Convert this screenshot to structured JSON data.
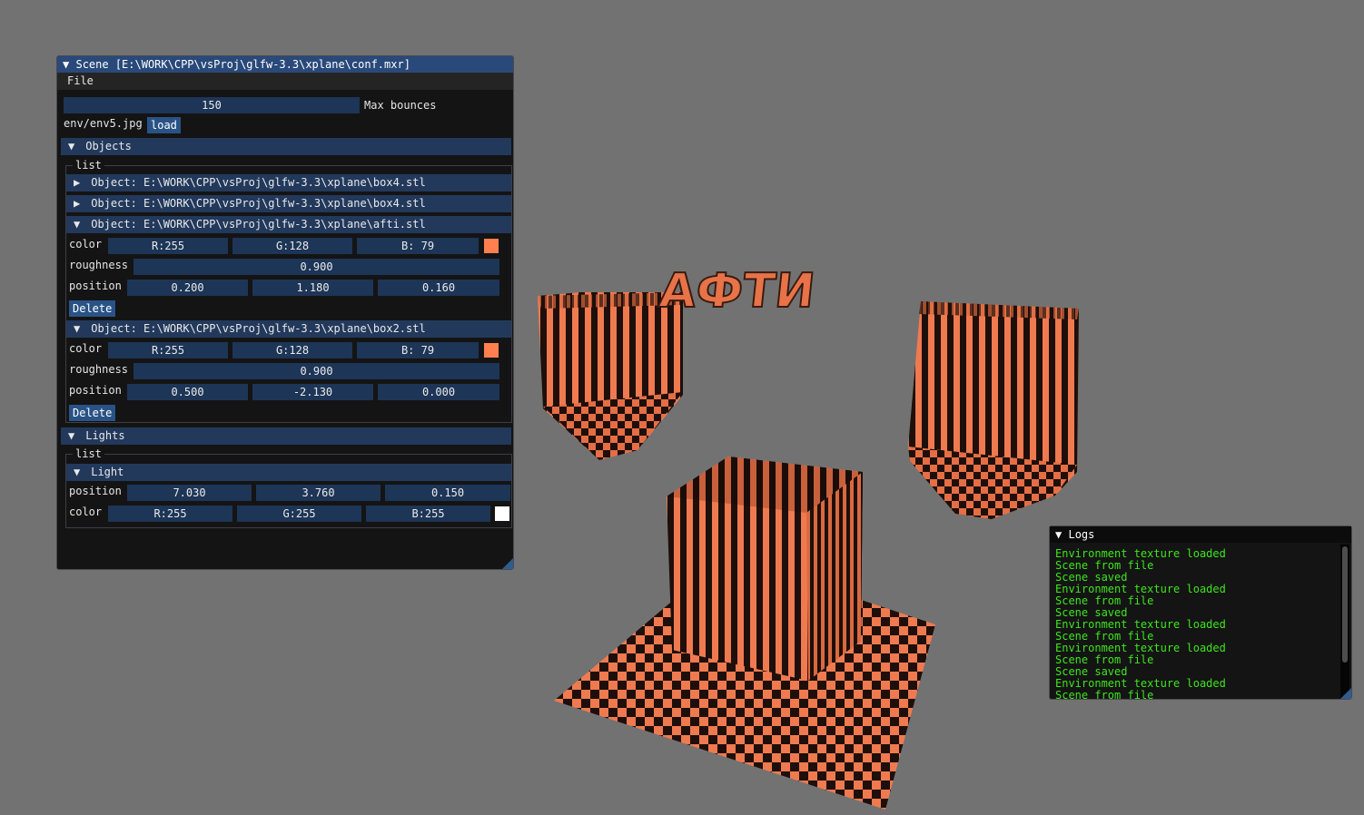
{
  "scene_window": {
    "title": "Scene [E:\\WORK\\CPP\\vsProj\\glfw-3.3\\xplane\\conf.mxr]",
    "menu": {
      "file": "File"
    },
    "max_bounces": {
      "value": "150",
      "label": "Max bounces"
    },
    "env": {
      "file": "env/env5.jpg",
      "load_label": "load"
    },
    "objects": {
      "header": "Objects",
      "list_label": "list",
      "collapsed_items": [
        "Object: E:\\WORK\\CPP\\vsProj\\glfw-3.3\\xplane\\box4.stl",
        "Object: E:\\WORK\\CPP\\vsProj\\glfw-3.3\\xplane\\box4.stl"
      ],
      "expanded_items": [
        {
          "title": "Object: E:\\WORK\\CPP\\vsProj\\glfw-3.3\\xplane\\afti.stl",
          "color_label": "color",
          "color": [
            "R:255",
            "G:128",
            "B: 79"
          ],
          "swatch": "#ff804f",
          "roughness_label": "roughness",
          "roughness": "0.900",
          "position_label": "position",
          "position": [
            "0.200",
            "1.180",
            "0.160"
          ],
          "delete_label": "Delete"
        },
        {
          "title": "Object: E:\\WORK\\CPP\\vsProj\\glfw-3.3\\xplane\\box2.stl",
          "color_label": "color",
          "color": [
            "R:255",
            "G:128",
            "B: 79"
          ],
          "swatch": "#ff804f",
          "roughness_label": "roughness",
          "roughness": "0.900",
          "position_label": "position",
          "position": [
            "0.500",
            "-2.130",
            "0.000"
          ],
          "delete_label": "Delete"
        }
      ]
    },
    "lights": {
      "header": "Lights",
      "list_label": "list",
      "light": {
        "title": "Light",
        "position_label": "position",
        "position": [
          "7.030",
          "3.760",
          "0.150"
        ],
        "color_label": "color",
        "color": [
          "R:255",
          "G:255",
          "B:255"
        ],
        "swatch": "#ffffff"
      }
    }
  },
  "logs_window": {
    "title": "Logs",
    "lines": [
      "Environment texture loaded",
      "Scene from file",
      "Scene saved",
      "Environment texture loaded",
      "Scene from file",
      "Scene saved",
      "Environment texture loaded",
      "Scene from file",
      "Environment texture loaded",
      "Scene from file",
      "Scene saved",
      "Environment texture loaded",
      "Scene from file"
    ]
  },
  "viewport": {
    "text_object": "АФТИ",
    "object_color": "#f07a4f",
    "dark_color": "#1e0f0b",
    "background": "#727272"
  }
}
